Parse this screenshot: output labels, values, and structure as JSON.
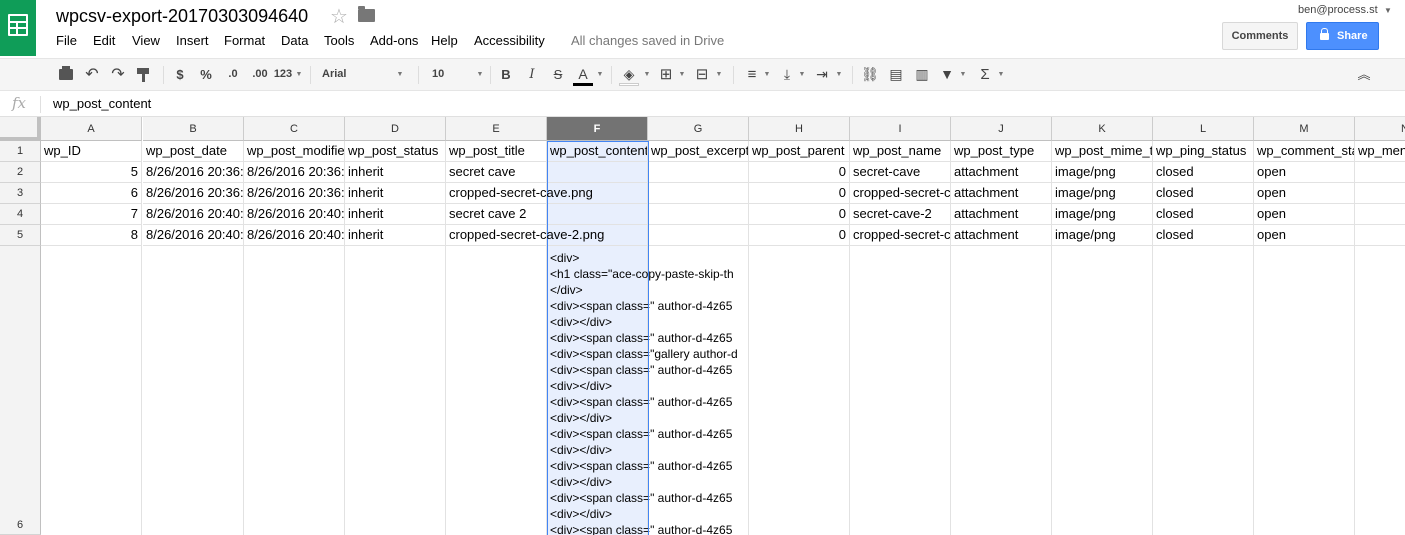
{
  "app": {
    "title": "wpcsv-export-20170303094640",
    "saved_status": "All changes saved in Drive",
    "user": "ben@process.st",
    "comments_label": "Comments",
    "share_label": "Share",
    "brand_color": "#0f9d58",
    "share_color": "#4d90fe"
  },
  "menu": [
    "File",
    "Edit",
    "View",
    "Insert",
    "Format",
    "Data",
    "Tools",
    "Add-ons",
    "Help",
    "Accessibility"
  ],
  "toolbar": {
    "currency": "$",
    "percent": "%",
    "decrease_decimals": ".0",
    "increase_decimals": ".00",
    "more_formats": "123",
    "font": "Arial",
    "font_size": "10",
    "bold": "B",
    "italic": "I",
    "strikethrough": "S",
    "text_color": "A",
    "sum": "Σ",
    "collapse": "︽"
  },
  "formula": {
    "fx": "fx",
    "value": "wp_post_content"
  },
  "sheet": {
    "selected_column": "F",
    "columns": [
      "A",
      "B",
      "C",
      "D",
      "E",
      "F",
      "G",
      "H",
      "I",
      "J",
      "K",
      "L",
      "M",
      "N"
    ],
    "rows": [
      "1",
      "2",
      "3",
      "4",
      "5",
      "6"
    ],
    "headers": [
      "wp_ID",
      "wp_post_date",
      "wp_post_modified",
      "wp_post_status",
      "wp_post_title",
      "wp_post_content",
      "wp_post_excerpt",
      "wp_post_parent",
      "wp_post_name",
      "wp_post_type",
      "wp_post_mime_type",
      "wp_ping_status",
      "wp_comment_status",
      "wp_menu"
    ],
    "data": [
      [
        "5",
        "8/26/2016 20:36:",
        "8/26/2016 20:36:",
        "inherit",
        "secret cave",
        "",
        "",
        "0",
        "secret-cave",
        "attachment",
        "image/png",
        "closed",
        "open",
        ""
      ],
      [
        "6",
        "8/26/2016 20:36:",
        "8/26/2016 20:36:",
        "inherit",
        "cropped-secret-cave.png",
        "",
        "",
        "0",
        "cropped-secret-c",
        "attachment",
        "image/png",
        "closed",
        "open",
        ""
      ],
      [
        "7",
        "8/26/2016 20:40:",
        "8/26/2016 20:40:",
        "inherit",
        "secret cave 2",
        "",
        "",
        "0",
        "secret-cave-2",
        "attachment",
        "image/png",
        "closed",
        "open",
        ""
      ],
      [
        "8",
        "8/26/2016 20:40:",
        "8/26/2016 20:40:",
        "inherit",
        "cropped-secret-cave-2.png",
        "",
        "",
        "0",
        "cropped-secret-c",
        "attachment",
        "image/png",
        "closed",
        "open",
        ""
      ]
    ],
    "row6_content_lines": [
      "<div>",
      "<h1 class=\"ace-copy-paste-skip-th",
      "</div>",
      "<div><span class=\" author-d-4z65",
      "<div></div>",
      "<div><span class=\" author-d-4z65",
      "<div><span class=\"gallery author-d",
      "<div><span class=\" author-d-4z65",
      "<div></div>",
      "<div><span class=\" author-d-4z65",
      "<div></div>",
      "<div><span class=\" author-d-4z65",
      "<div></div>",
      "<div><span class=\" author-d-4z65",
      "<div></div>",
      "<div><span class=\" author-d-4z65",
      "<div></div>",
      "<div><span class=\" author-d-4z65"
    ]
  }
}
